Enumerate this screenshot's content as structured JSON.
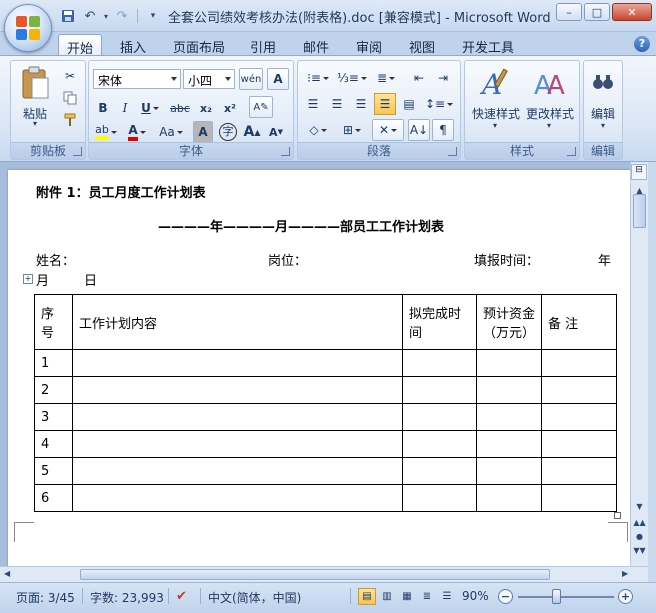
{
  "window": {
    "title": "全套公司绩效考核办法(附表格).doc [兼容模式] - Microsoft Word",
    "controls": {
      "minimize": "–",
      "maximize": "□",
      "close": "✕"
    }
  },
  "tabs": [
    "开始",
    "插入",
    "页面布局",
    "引用",
    "邮件",
    "审阅",
    "视图",
    "开发工具"
  ],
  "active_tab": "开始",
  "ribbon": {
    "clipboard": {
      "label": "剪贴板",
      "paste": "粘贴"
    },
    "font": {
      "label": "字体",
      "font_name": "宋体",
      "font_size": "小四",
      "bold": "B",
      "italic": "I",
      "underline": "U",
      "strike": "abc",
      "subscript": "x₂",
      "superscript": "x²",
      "font_color": "A",
      "case": "Aa",
      "grow": "A",
      "shrink": "A"
    },
    "paragraph": {
      "label": "段落"
    },
    "styles": {
      "label": "样式",
      "quick_styles": "快速样式",
      "change_styles": "更改样式"
    },
    "editing": {
      "label": "编辑",
      "edit": "编辑"
    }
  },
  "document": {
    "attachment_title": "附件 1：员工月度工作计划表",
    "table_title": "————年————月————部员工工作计划表",
    "name_label": "姓名：",
    "position_label": "岗位：",
    "fill_time_label": "填报时间：",
    "year_label": "年",
    "month_label": "月",
    "day_label": "日",
    "table": {
      "headers": [
        "序号",
        "工作计划内容",
        "拟完成时间",
        "预计资金（万元）",
        "备 注"
      ],
      "rows": [
        "1",
        "2",
        "3",
        "4",
        "5",
        "6"
      ]
    }
  },
  "status": {
    "page": "页面: 3/45",
    "words": "字数: 23,993",
    "language": "中文(简体，中国)",
    "zoom": "90%"
  }
}
